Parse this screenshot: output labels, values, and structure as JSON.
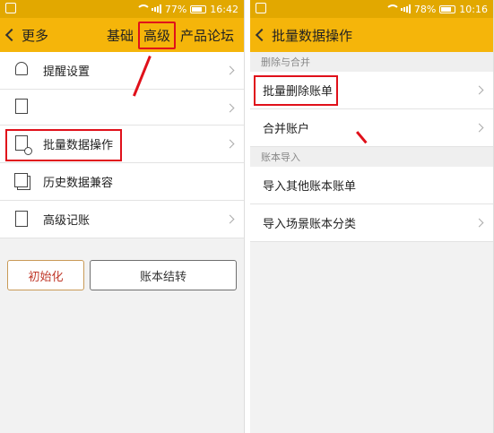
{
  "left": {
    "status": {
      "battery": "77%",
      "time": "16:42"
    },
    "header": {
      "back_label": "更多",
      "tabs": [
        "基础",
        "高级",
        "产品论坛"
      ]
    },
    "menu": [
      {
        "label": "提醒设置",
        "icon": "bell-icon"
      },
      {
        "label": "",
        "icon": "document-icon"
      },
      {
        "label": "批量数据操作",
        "icon": "batch-settings-icon"
      },
      {
        "label": "历史数据兼容",
        "icon": "history-icon"
      },
      {
        "label": "高级记账",
        "icon": "calculator-icon"
      }
    ],
    "buttons": {
      "init": "初始化",
      "close_books": "账本结转"
    }
  },
  "right": {
    "status": {
      "battery": "78%",
      "time": "10:16"
    },
    "header": {
      "back_label": "批量数据操作"
    },
    "sections": [
      {
        "title": "删除与合并",
        "items": [
          "批量删除账单",
          "合并账户"
        ]
      },
      {
        "title": "账本导入",
        "items": [
          "导入其他账本账单",
          "导入场景账本分类"
        ]
      }
    ]
  },
  "colors": {
    "header": "#f5b50a",
    "status_bar": "#e2a800",
    "highlight": "#e0101a"
  }
}
